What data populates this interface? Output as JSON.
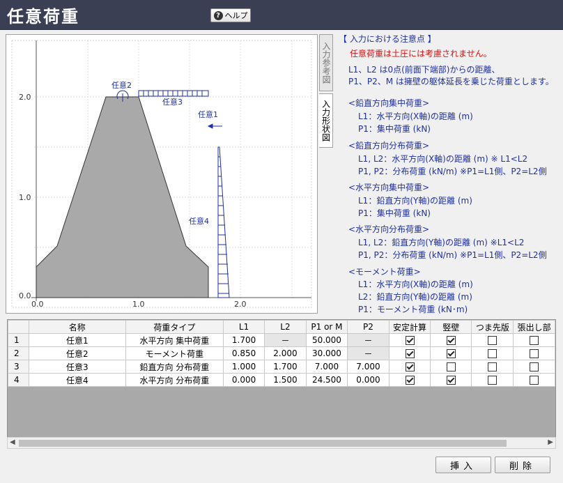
{
  "title": "任意荷重",
  "help_label": "ヘルプ",
  "tabs": {
    "reference": "入力参考図",
    "shape": "入力形状図"
  },
  "diagram": {
    "y_ticks": [
      "2.0",
      "1.0",
      "0.0"
    ],
    "x_ticks": [
      "0.0",
      "1.0",
      "2.0"
    ],
    "load_labels": [
      "任意2",
      "任意3",
      "任意1",
      "任意4"
    ]
  },
  "notes": {
    "heading": "【 入力における注意点 】",
    "warning": "任意荷重は土圧には考慮されません。",
    "general": [
      "L1、L2 は0点(前面下端部)からの距離、",
      "P1、P2、M は擁壁の躯体延長を乗じた荷重とします。"
    ],
    "sections": [
      {
        "title": "<鉛直方向集中荷重>",
        "lines": [
          "L1：水平方向(X軸)の距離 (m)",
          "P1：集中荷重 (kN)"
        ]
      },
      {
        "title": "<鉛直方向分布荷重>",
        "lines": [
          "L1, L2：水平方向(X軸)の距離 (m) ※ L1<L2",
          "P1, P2：分布荷重 (kN/m) ※P1=L1側、P2=L2側"
        ]
      },
      {
        "title": "<水平方向集中荷重>",
        "lines": [
          "L1：鉛直方向(Y軸)の距離 (m)",
          "P1：集中荷重 (kN)"
        ]
      },
      {
        "title": "<水平方向分布荷重>",
        "lines": [
          "L1, L2：鉛直方向(Y軸)の距離 (m) ※L1<L2",
          "P1, P2：分布荷重 (kN/m) ※P1=L1側、P2=L2側"
        ]
      },
      {
        "title": "<モーメント荷重>",
        "lines": [
          "L1：水平方向(X軸)の距離 (m)",
          "L2：鉛直方向(Y軸)の距離 (m)",
          "P1：モーメント荷重 (kN･m)"
        ]
      }
    ]
  },
  "table": {
    "headers": [
      "",
      "名称",
      "荷重タイプ",
      "L1",
      "L2",
      "P1 or M",
      "P2",
      "安定計算",
      "竪壁",
      "つま先版",
      "張出し部"
    ],
    "rows": [
      {
        "no": "1",
        "name": "任意1",
        "type": "水平方向 集中荷重",
        "l1": "1.700",
        "l2": "－",
        "p1": "50.000",
        "p2": "－",
        "stab": true,
        "wall": true,
        "toe": false,
        "over": false
      },
      {
        "no": "2",
        "name": "任意2",
        "type": "モーメント荷重",
        "l1": "0.850",
        "l2": "2.000",
        "p1": "30.000",
        "p2": "－",
        "stab": true,
        "wall": true,
        "toe": false,
        "over": false
      },
      {
        "no": "3",
        "name": "任意3",
        "type": "鉛直方向 分布荷重",
        "l1": "1.000",
        "l2": "1.700",
        "p1": "7.000",
        "p2": "7.000",
        "stab": true,
        "wall": false,
        "toe": false,
        "over": false
      },
      {
        "no": "4",
        "name": "任意4",
        "type": "水平方向 分布荷重",
        "l1": "0.000",
        "l2": "1.500",
        "p1": "24.500",
        "p2": "0.000",
        "stab": true,
        "wall": true,
        "toe": false,
        "over": false
      }
    ]
  },
  "buttons": {
    "insert": "挿入",
    "delete": "削除"
  }
}
